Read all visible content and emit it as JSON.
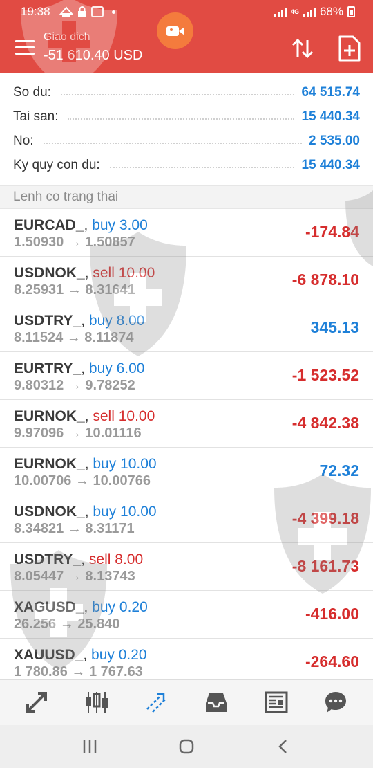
{
  "status_bar": {
    "time": "19:38",
    "network": "4G",
    "battery": "68%"
  },
  "header": {
    "title": "Giao dich",
    "profit": "-51 610.40 USD",
    "colors": {
      "background": "#e14b43",
      "record_button": "#f47b3d"
    }
  },
  "summary": [
    {
      "label": "So du:",
      "value": "64 515.74"
    },
    {
      "label": "Tai san:",
      "value": "15 440.34"
    },
    {
      "label": "No:",
      "value": "2 535.00"
    },
    {
      "label": "Ky quy con du:",
      "value": "15 440.34"
    }
  ],
  "section_title": "Lenh co trang thai",
  "positions": [
    {
      "symbol": "EURCAD_",
      "side": "buy",
      "volume": "buy 3.00",
      "prices": "1.50930 → 1.50857",
      "profit": "-174.84"
    },
    {
      "symbol": "USDNOK_",
      "side": "sell",
      "volume": "sell 10.00",
      "prices": "8.25931 → 8.31641",
      "profit": "-6 878.10"
    },
    {
      "symbol": "USDTRY_",
      "side": "buy",
      "volume": "buy 8.00",
      "prices": "8.11524 → 8.11874",
      "profit": "345.13"
    },
    {
      "symbol": "EURTRY_",
      "side": "buy",
      "volume": "buy 6.00",
      "prices": "9.80312 → 9.78252",
      "profit": "-1 523.52"
    },
    {
      "symbol": "EURNOK_",
      "side": "sell",
      "volume": "sell 10.00",
      "prices": "9.97096 → 10.01116",
      "profit": "-4 842.38"
    },
    {
      "symbol": "EURNOK_",
      "side": "buy",
      "volume": "buy 10.00",
      "prices": "10.00706 → 10.00766",
      "profit": "72.32"
    },
    {
      "symbol": "USDNOK_",
      "side": "buy",
      "volume": "buy 10.00",
      "prices": "8.34821 → 8.31171",
      "profit": "-4 399.18"
    },
    {
      "symbol": "USDTRY_",
      "side": "sell",
      "volume": "sell 8.00",
      "prices": "8.05447 → 8.13743",
      "profit": "-8 161.73"
    },
    {
      "symbol": "XAGUSD_",
      "side": "buy",
      "volume": "buy 0.20",
      "prices": "26.256 → 25.840",
      "profit": "-416.00"
    },
    {
      "symbol": "XAUUSD_",
      "side": "buy",
      "volume": "buy 0.20",
      "prices": "1 780.86 → 1 767.63",
      "profit": "-264.60"
    }
  ],
  "toolbar": [
    "quotes-icon",
    "chart-icon",
    "trade-icon",
    "history-icon",
    "news-icon",
    "chat-icon"
  ],
  "colors": {
    "buy": "#1e80d8",
    "sell": "#d62d2d",
    "value": "#1e80d8"
  }
}
